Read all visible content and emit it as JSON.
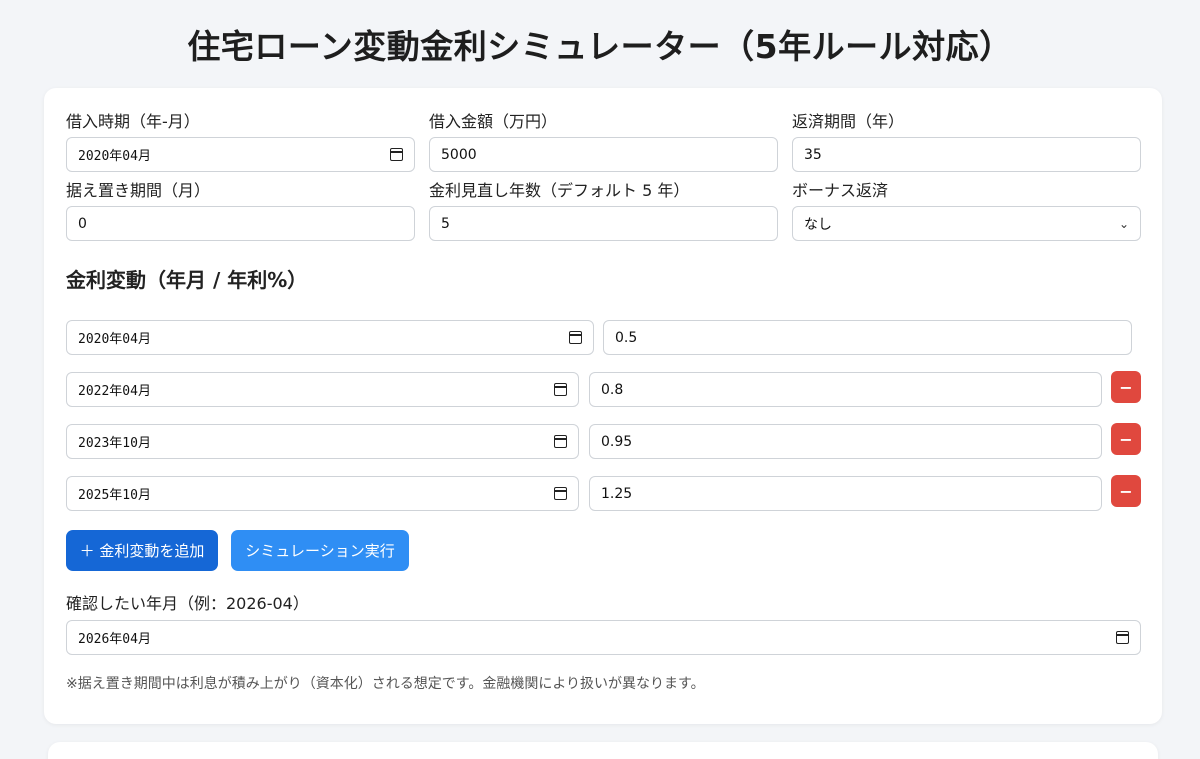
{
  "title": "住宅ローン変動金利シミュレーター（5年ルール対応）",
  "form": {
    "borrow_date": {
      "label": "借入時期（年-月）",
      "value": "2020年04月"
    },
    "amount": {
      "label": "借入金額（万円）",
      "value": "5000"
    },
    "term": {
      "label": "返済期間（年）",
      "value": "35"
    },
    "grace": {
      "label": "据え置き期間（月）",
      "value": "0"
    },
    "review_years": {
      "label": "金利見直し年数（デフォルト 5 年）",
      "value": "5"
    },
    "bonus": {
      "label": "ボーナス返済",
      "value": "なし"
    }
  },
  "rates": {
    "title": "金利変動（年月 / 年利%）",
    "rows": [
      {
        "month": "2020年04月",
        "rate": "0.5"
      },
      {
        "month": "2022年04月",
        "rate": "0.8"
      },
      {
        "month": "2023年10月",
        "rate": "0.95"
      },
      {
        "month": "2025年10月",
        "rate": "1.25"
      }
    ],
    "remove_label": "−"
  },
  "buttons": {
    "add": "＋ 金利変動を追加",
    "run": "シミュレーション実行"
  },
  "check": {
    "label": "確認したい年月（例：2026-04）",
    "value": "2026年04月"
  },
  "note": "※据え置き期間中は利息が積み上がり（資本化）される想定です。金融機関により扱いが異なります。"
}
